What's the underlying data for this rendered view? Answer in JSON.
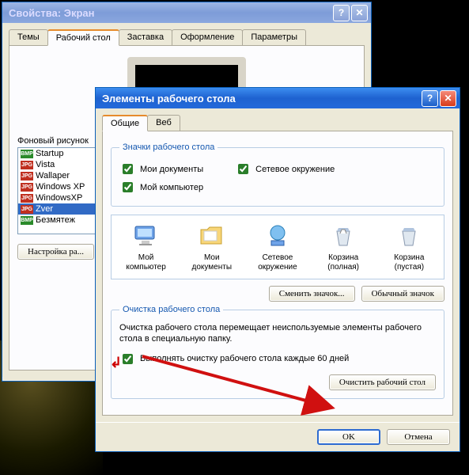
{
  "parent_window": {
    "title": "Свойства: Экран",
    "tabs": [
      "Темы",
      "Рабочий стол",
      "Заставка",
      "Оформление",
      "Параметры"
    ],
    "active_tab": "Рабочий стол",
    "wallpaper_label": "Фоновый рисунок",
    "wallpapers": [
      {
        "type": "bmp",
        "name": "Startup"
      },
      {
        "type": "jpg",
        "name": "Vista"
      },
      {
        "type": "jpg",
        "name": "Wallaper"
      },
      {
        "type": "jpg",
        "name": "Windows XP"
      },
      {
        "type": "jpg",
        "name": "WindowsXP"
      },
      {
        "type": "jpg",
        "name": "Zver",
        "selected": true
      },
      {
        "type": "bmp",
        "name": "Безмятеж"
      }
    ],
    "customize_btn": "Настройка ра..."
  },
  "child_window": {
    "title": "Элементы рабочего стола",
    "tabs": [
      "Общие",
      "Веб"
    ],
    "active_tab": "Общие",
    "group_icons": {
      "legend": "Значки рабочего стола",
      "checks": [
        {
          "label": "Мои документы",
          "checked": true
        },
        {
          "label": "Сетевое окружение",
          "checked": true
        },
        {
          "label": "Мой компьютер",
          "checked": true
        }
      ]
    },
    "icon_select": {
      "items": [
        {
          "name": "Мой компьютер"
        },
        {
          "name": "Мои документы"
        },
        {
          "name": "Сетевое окружение"
        },
        {
          "name": "Корзина (полная)"
        },
        {
          "name": "Корзина (пустая)"
        }
      ],
      "change_btn": "Сменить значок...",
      "default_btn": "Обычный значок"
    },
    "cleanup": {
      "legend": "Очистка рабочего стола",
      "desc": "Очистка рабочего стола перемещает неиспользуемые элементы рабочего стола в специальную папку.",
      "check_label": "Выполнять очистку рабочего стола каждые 60 дней",
      "check_checked": true,
      "clean_btn": "Очистить рабочий стол"
    },
    "ok": "OK",
    "cancel": "Отмена"
  }
}
